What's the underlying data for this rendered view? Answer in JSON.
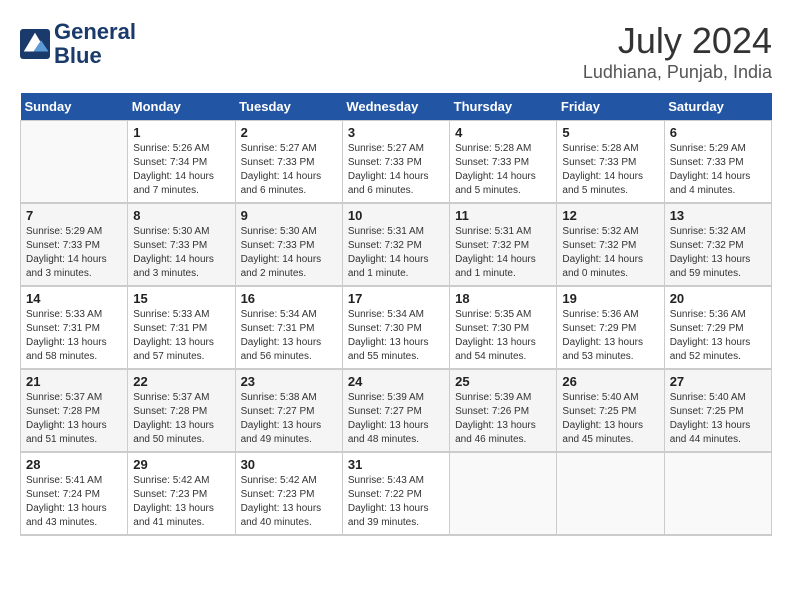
{
  "header": {
    "logo_line1": "General",
    "logo_line2": "Blue",
    "title": "July 2024",
    "subtitle": "Ludhiana, Punjab, India"
  },
  "days_of_week": [
    "Sunday",
    "Monday",
    "Tuesday",
    "Wednesday",
    "Thursday",
    "Friday",
    "Saturday"
  ],
  "weeks": [
    [
      {
        "day": "",
        "sunrise": "",
        "sunset": "",
        "daylight": ""
      },
      {
        "day": "1",
        "sunrise": "Sunrise: 5:26 AM",
        "sunset": "Sunset: 7:34 PM",
        "daylight": "Daylight: 14 hours and 7 minutes."
      },
      {
        "day": "2",
        "sunrise": "Sunrise: 5:27 AM",
        "sunset": "Sunset: 7:33 PM",
        "daylight": "Daylight: 14 hours and 6 minutes."
      },
      {
        "day": "3",
        "sunrise": "Sunrise: 5:27 AM",
        "sunset": "Sunset: 7:33 PM",
        "daylight": "Daylight: 14 hours and 6 minutes."
      },
      {
        "day": "4",
        "sunrise": "Sunrise: 5:28 AM",
        "sunset": "Sunset: 7:33 PM",
        "daylight": "Daylight: 14 hours and 5 minutes."
      },
      {
        "day": "5",
        "sunrise": "Sunrise: 5:28 AM",
        "sunset": "Sunset: 7:33 PM",
        "daylight": "Daylight: 14 hours and 5 minutes."
      },
      {
        "day": "6",
        "sunrise": "Sunrise: 5:29 AM",
        "sunset": "Sunset: 7:33 PM",
        "daylight": "Daylight: 14 hours and 4 minutes."
      }
    ],
    [
      {
        "day": "7",
        "sunrise": "Sunrise: 5:29 AM",
        "sunset": "Sunset: 7:33 PM",
        "daylight": "Daylight: 14 hours and 3 minutes."
      },
      {
        "day": "8",
        "sunrise": "Sunrise: 5:30 AM",
        "sunset": "Sunset: 7:33 PM",
        "daylight": "Daylight: 14 hours and 3 minutes."
      },
      {
        "day": "9",
        "sunrise": "Sunrise: 5:30 AM",
        "sunset": "Sunset: 7:33 PM",
        "daylight": "Daylight: 14 hours and 2 minutes."
      },
      {
        "day": "10",
        "sunrise": "Sunrise: 5:31 AM",
        "sunset": "Sunset: 7:32 PM",
        "daylight": "Daylight: 14 hours and 1 minute."
      },
      {
        "day": "11",
        "sunrise": "Sunrise: 5:31 AM",
        "sunset": "Sunset: 7:32 PM",
        "daylight": "Daylight: 14 hours and 1 minute."
      },
      {
        "day": "12",
        "sunrise": "Sunrise: 5:32 AM",
        "sunset": "Sunset: 7:32 PM",
        "daylight": "Daylight: 14 hours and 0 minutes."
      },
      {
        "day": "13",
        "sunrise": "Sunrise: 5:32 AM",
        "sunset": "Sunset: 7:32 PM",
        "daylight": "Daylight: 13 hours and 59 minutes."
      }
    ],
    [
      {
        "day": "14",
        "sunrise": "Sunrise: 5:33 AM",
        "sunset": "Sunset: 7:31 PM",
        "daylight": "Daylight: 13 hours and 58 minutes."
      },
      {
        "day": "15",
        "sunrise": "Sunrise: 5:33 AM",
        "sunset": "Sunset: 7:31 PM",
        "daylight": "Daylight: 13 hours and 57 minutes."
      },
      {
        "day": "16",
        "sunrise": "Sunrise: 5:34 AM",
        "sunset": "Sunset: 7:31 PM",
        "daylight": "Daylight: 13 hours and 56 minutes."
      },
      {
        "day": "17",
        "sunrise": "Sunrise: 5:34 AM",
        "sunset": "Sunset: 7:30 PM",
        "daylight": "Daylight: 13 hours and 55 minutes."
      },
      {
        "day": "18",
        "sunrise": "Sunrise: 5:35 AM",
        "sunset": "Sunset: 7:30 PM",
        "daylight": "Daylight: 13 hours and 54 minutes."
      },
      {
        "day": "19",
        "sunrise": "Sunrise: 5:36 AM",
        "sunset": "Sunset: 7:29 PM",
        "daylight": "Daylight: 13 hours and 53 minutes."
      },
      {
        "day": "20",
        "sunrise": "Sunrise: 5:36 AM",
        "sunset": "Sunset: 7:29 PM",
        "daylight": "Daylight: 13 hours and 52 minutes."
      }
    ],
    [
      {
        "day": "21",
        "sunrise": "Sunrise: 5:37 AM",
        "sunset": "Sunset: 7:28 PM",
        "daylight": "Daylight: 13 hours and 51 minutes."
      },
      {
        "day": "22",
        "sunrise": "Sunrise: 5:37 AM",
        "sunset": "Sunset: 7:28 PM",
        "daylight": "Daylight: 13 hours and 50 minutes."
      },
      {
        "day": "23",
        "sunrise": "Sunrise: 5:38 AM",
        "sunset": "Sunset: 7:27 PM",
        "daylight": "Daylight: 13 hours and 49 minutes."
      },
      {
        "day": "24",
        "sunrise": "Sunrise: 5:39 AM",
        "sunset": "Sunset: 7:27 PM",
        "daylight": "Daylight: 13 hours and 48 minutes."
      },
      {
        "day": "25",
        "sunrise": "Sunrise: 5:39 AM",
        "sunset": "Sunset: 7:26 PM",
        "daylight": "Daylight: 13 hours and 46 minutes."
      },
      {
        "day": "26",
        "sunrise": "Sunrise: 5:40 AM",
        "sunset": "Sunset: 7:25 PM",
        "daylight": "Daylight: 13 hours and 45 minutes."
      },
      {
        "day": "27",
        "sunrise": "Sunrise: 5:40 AM",
        "sunset": "Sunset: 7:25 PM",
        "daylight": "Daylight: 13 hours and 44 minutes."
      }
    ],
    [
      {
        "day": "28",
        "sunrise": "Sunrise: 5:41 AM",
        "sunset": "Sunset: 7:24 PM",
        "daylight": "Daylight: 13 hours and 43 minutes."
      },
      {
        "day": "29",
        "sunrise": "Sunrise: 5:42 AM",
        "sunset": "Sunset: 7:23 PM",
        "daylight": "Daylight: 13 hours and 41 minutes."
      },
      {
        "day": "30",
        "sunrise": "Sunrise: 5:42 AM",
        "sunset": "Sunset: 7:23 PM",
        "daylight": "Daylight: 13 hours and 40 minutes."
      },
      {
        "day": "31",
        "sunrise": "Sunrise: 5:43 AM",
        "sunset": "Sunset: 7:22 PM",
        "daylight": "Daylight: 13 hours and 39 minutes."
      },
      {
        "day": "",
        "sunrise": "",
        "sunset": "",
        "daylight": ""
      },
      {
        "day": "",
        "sunrise": "",
        "sunset": "",
        "daylight": ""
      },
      {
        "day": "",
        "sunrise": "",
        "sunset": "",
        "daylight": ""
      }
    ]
  ]
}
